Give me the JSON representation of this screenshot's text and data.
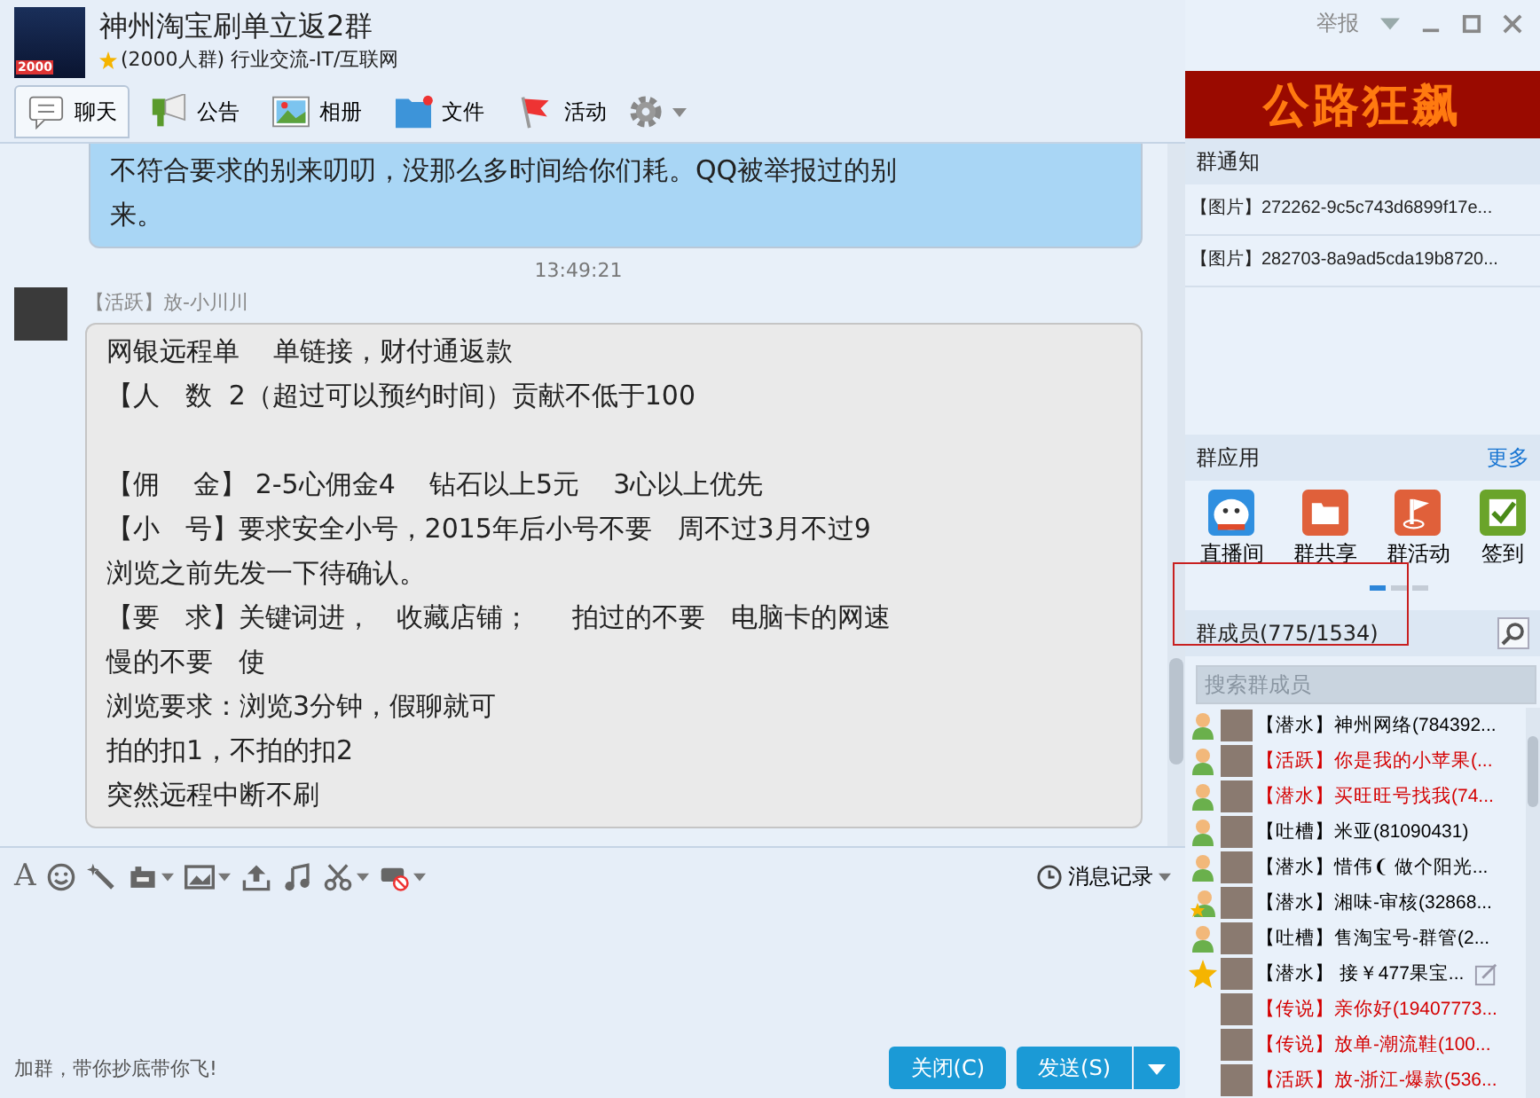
{
  "window": {
    "title": "神州淘宝刷单立返2群",
    "subtitle": "(2000人群) 行业交流-IT/互联网",
    "logo_text": "2000",
    "controls": [
      "举报"
    ]
  },
  "tabs": [
    {
      "label": "聊天",
      "selected": true,
      "kind": "chat"
    },
    {
      "label": "公告",
      "selected": false,
      "kind": "notice"
    },
    {
      "label": "相册",
      "selected": false,
      "kind": "album"
    },
    {
      "label": "文件",
      "selected": false,
      "kind": "file"
    },
    {
      "label": "活动",
      "selected": false,
      "kind": "event"
    }
  ],
  "messages": [
    {
      "kind": "own",
      "lines": [
        "不符合要求的别来叨叨，没那么多时间给你们耗。QQ被举报过的别",
        "来。"
      ]
    },
    {
      "kind": "time",
      "text": "13:49:21"
    },
    {
      "kind": "other",
      "sender": "【活跃】放-小川川",
      "paragraphs": [
        [
          "网银远程单    单链接，财付通返款",
          "【人   数  2（超过可以预约时间）贡献不低于100"
        ],
        [
          "【佣    金】 2-5心佣金4    钻石以上5元    3心以上优先",
          "【小   号】要求安全小号，2015年后小号不要   周不过3月不过9",
          "浏览之前先发一下待确认。",
          "【要   求】关键词进，   收藏店铺；     拍过的不要   电脑卡的网速",
          "慢的不要   使",
          "浏览要求：浏览3分钟，假聊就可",
          "拍的扣1，不拍的扣2",
          "突然远程中断不刷"
        ]
      ]
    }
  ],
  "input": {
    "font_label": "A",
    "history_label": "消息记录",
    "hint": "加群，带你抄底带你飞!",
    "buttons": [
      "关闭(C)",
      "发送(S)"
    ]
  },
  "ad": {
    "text": "公路狂飙"
  },
  "notices": {
    "title": "群通知",
    "items": [
      "【图片】272262-9c5c743d6899f17e...",
      "【图片】282703-8a9ad5cda19b8720..."
    ]
  },
  "apps": {
    "title": "群应用",
    "more": "更多",
    "items": [
      {
        "label": "直播间",
        "kind": "live"
      },
      {
        "label": "群共享",
        "kind": "share"
      },
      {
        "label": "群活动",
        "kind": "activity"
      },
      {
        "label": "签到",
        "kind": "checkin"
      }
    ],
    "pages": [
      {
        "selected": true
      },
      {
        "selected": false
      },
      {
        "selected": false
      }
    ]
  },
  "members": {
    "title": "群成员(775/1534)",
    "search_placeholder": "搜索群成员",
    "items": [
      {
        "kind": "member",
        "name": "【潜水】神州网络(784392...",
        "color": "#000000"
      },
      {
        "kind": "member",
        "name": "【活跃】你是我的小苹果(...",
        "color": "#d40000"
      },
      {
        "kind": "member",
        "name": "【潜水】买旺旺号找我(74...",
        "color": "#d40000"
      },
      {
        "kind": "member",
        "name": "【吐槽】米亚(81090431)",
        "color": "#000000"
      },
      {
        "kind": "member",
        "name": "【潜水】惜伟❨ 做个阳光...",
        "color": "#000000"
      },
      {
        "kind": "admin",
        "name": "【潜水】湘味-审核(32868...",
        "color": "#000000"
      },
      {
        "kind": "member",
        "name": "【吐槽】售淘宝号-群管(2...",
        "color": "#000000"
      },
      {
        "kind": "owner",
        "name": "【潜水】 接￥477果宝...",
        "color": "#000000"
      },
      {
        "kind": "plain",
        "name": "【传说】亲你好(19407773...",
        "color": "#d40000"
      },
      {
        "kind": "plain",
        "name": "【传说】放单-潮流鞋(100...",
        "color": "#d40000"
      },
      {
        "kind": "plain",
        "name": "【活跃】放-浙江-爆款(536...",
        "color": "#d40000"
      }
    ]
  }
}
